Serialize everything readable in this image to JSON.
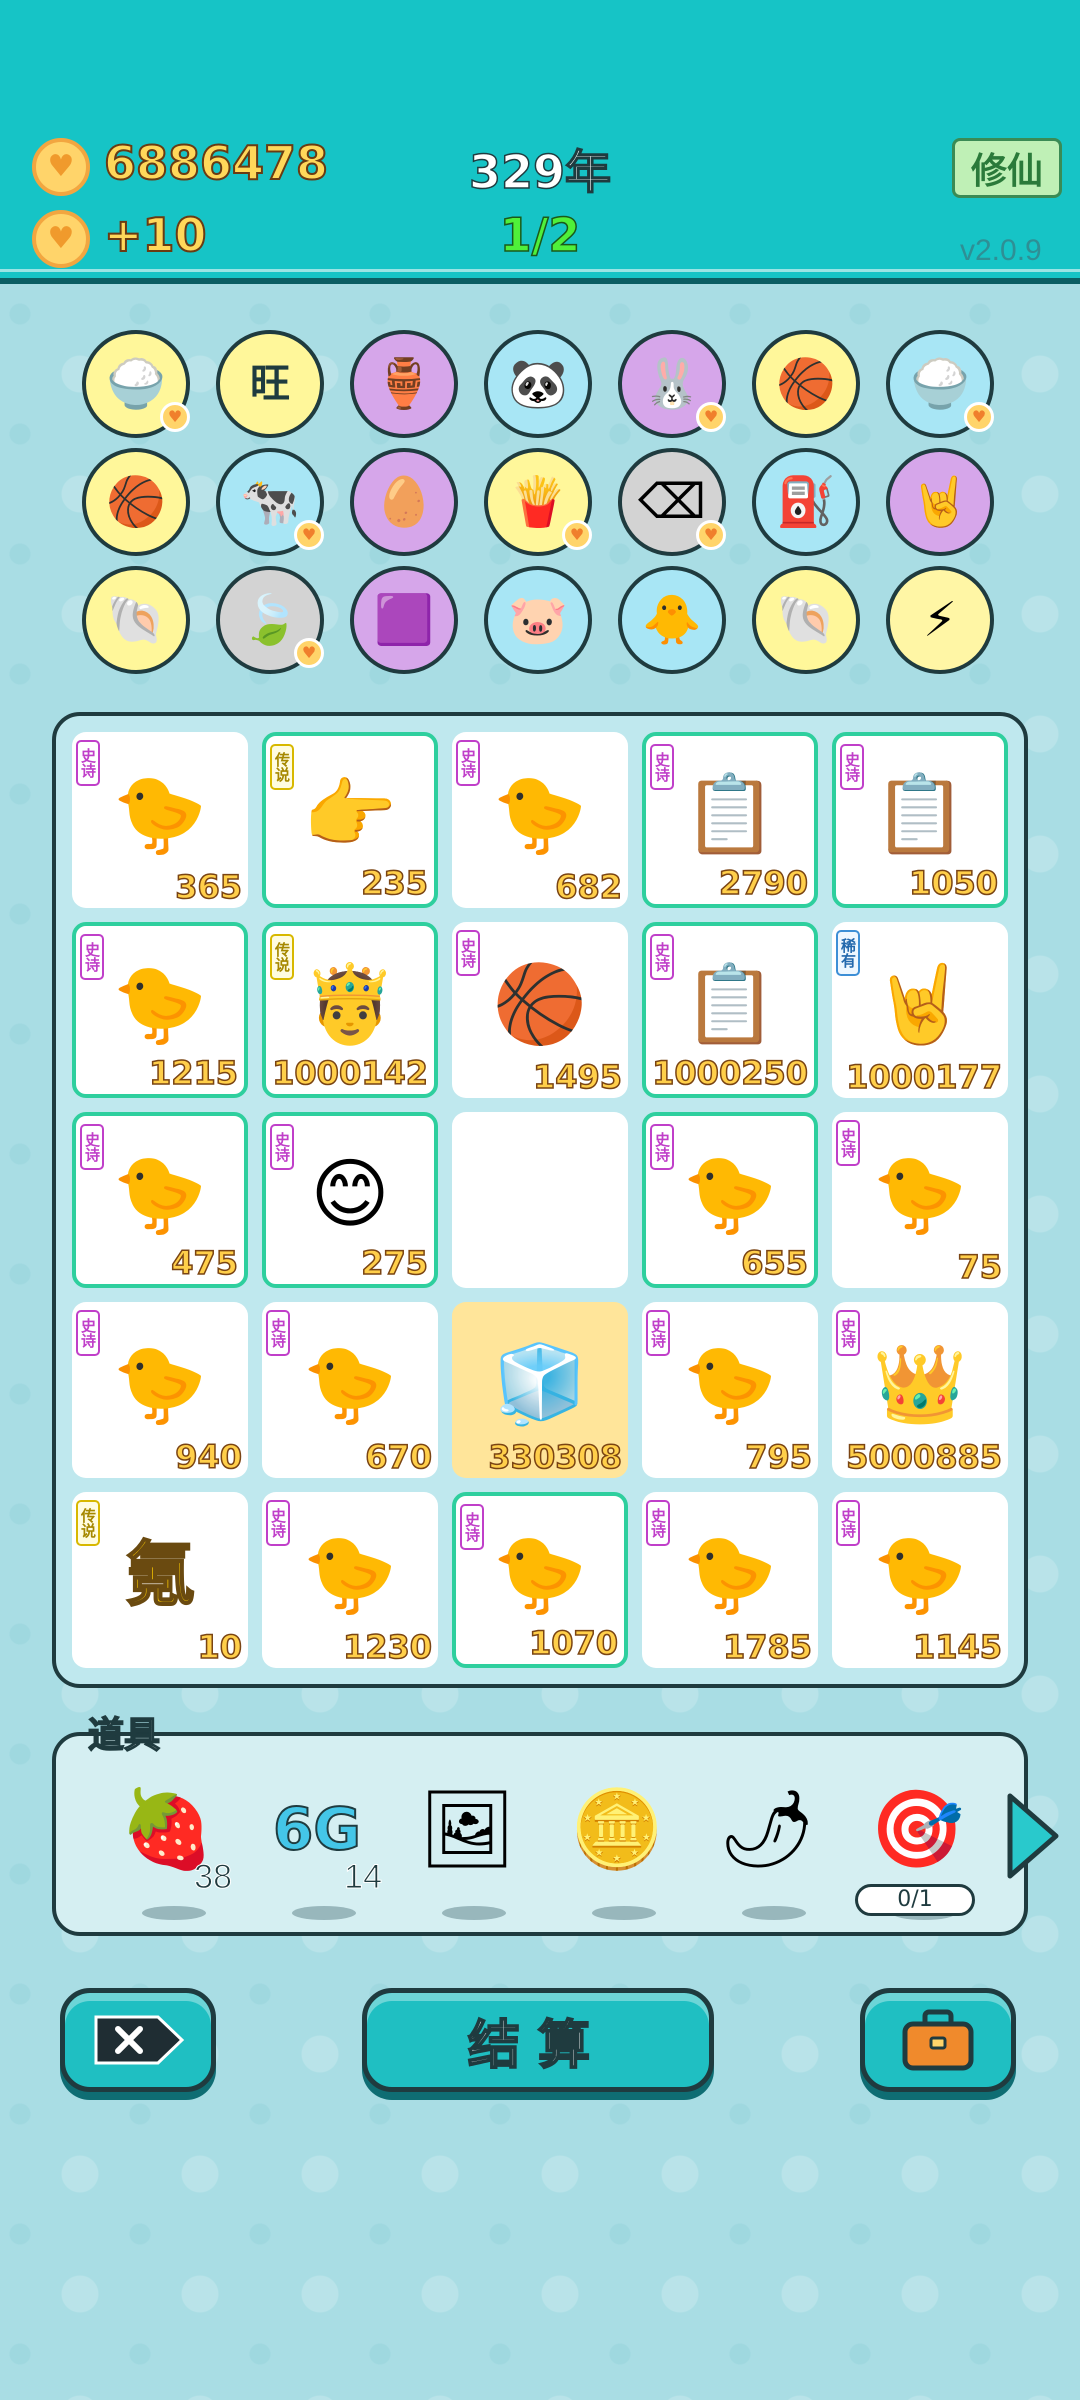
{
  "header": {
    "coins": "6886478",
    "coin_rate": "+10",
    "year": "329年",
    "progress": "1/2",
    "cultivate_button": "修仙",
    "version": "v2.0.9"
  },
  "icon_rows": [
    [
      {
        "icon": "🍚",
        "name": "rice-bowl-icon",
        "color": "yellow",
        "badge": true
      },
      {
        "icon": "旺",
        "name": "wang-character-icon",
        "color": "yellow",
        "badge": false
      },
      {
        "icon": "🏺",
        "name": "jar-icon",
        "color": "purple",
        "badge": false
      },
      {
        "icon": "🐼",
        "name": "panda-icon",
        "color": "blue",
        "badge": false
      },
      {
        "icon": "🐰",
        "name": "rabbit-icon",
        "color": "purple",
        "badge": true
      },
      {
        "icon": "🏀",
        "name": "basketball-icon",
        "color": "yellow",
        "badge": false
      },
      {
        "icon": "🍚",
        "name": "rice-bowl-icon",
        "color": "blue",
        "badge": true
      }
    ],
    [
      {
        "icon": "🏀",
        "name": "basketball-icon",
        "color": "yellow",
        "badge": false
      },
      {
        "icon": "🐄",
        "name": "cow-icon",
        "color": "blue",
        "badge": true
      },
      {
        "icon": "🥚",
        "name": "egg-icon",
        "color": "purple",
        "badge": false
      },
      {
        "icon": "🍟",
        "name": "fries-icon",
        "color": "yellow",
        "badge": true
      },
      {
        "icon": "⌫",
        "name": "delete-icon",
        "color": "gray",
        "badge": true
      },
      {
        "icon": "⛽",
        "name": "pump-icon",
        "color": "blue",
        "badge": false
      },
      {
        "icon": "🤘",
        "name": "rock-hand-icon",
        "color": "purple",
        "badge": false
      }
    ],
    [
      {
        "icon": "🐚",
        "name": "shell-icon",
        "color": "yellow",
        "badge": false
      },
      {
        "icon": "🍃",
        "name": "leaf-icon",
        "color": "gray",
        "badge": true
      },
      {
        "icon": "🟪",
        "name": "box-icon",
        "color": "purple",
        "badge": false
      },
      {
        "icon": "🐷",
        "name": "piggy-bank-icon",
        "color": "blue",
        "badge": false
      },
      {
        "icon": "🐥",
        "name": "chick-icon",
        "color": "blue",
        "badge": false
      },
      {
        "icon": "🐚",
        "name": "shell-icon",
        "color": "yellow",
        "badge": false
      },
      {
        "icon": "⚡",
        "name": "lightning-icon",
        "color": "lyellow",
        "badge": false
      }
    ]
  ],
  "board": {
    "rows": [
      [
        {
          "tag": "史诗",
          "tag_type": "epic",
          "icon": "🐤",
          "num": "365",
          "hl": false,
          "gold": false
        },
        {
          "tag": "传说",
          "tag_type": "legend",
          "icon": "👉",
          "num": "235",
          "hl": true,
          "gold": false
        },
        {
          "tag": "史诗",
          "tag_type": "epic",
          "icon": "🐤",
          "num": "682",
          "hl": false,
          "gold": false
        },
        {
          "tag": "史诗",
          "tag_type": "epic",
          "icon": "📋",
          "num": "2790",
          "hl": true,
          "gold": false
        },
        {
          "tag": "史诗",
          "tag_type": "epic",
          "icon": "📋",
          "num": "1050",
          "hl": true,
          "gold": false
        }
      ],
      [
        {
          "tag": "史诗",
          "tag_type": "epic",
          "icon": "🐤",
          "num": "1215",
          "hl": true,
          "gold": false
        },
        {
          "tag": "传说",
          "tag_type": "legend",
          "icon": "🤴",
          "num": "1000142",
          "hl": true,
          "gold": false
        },
        {
          "tag": "史诗",
          "tag_type": "epic",
          "icon": "🏀",
          "num": "1495",
          "hl": false,
          "gold": false
        },
        {
          "tag": "史诗",
          "tag_type": "epic",
          "icon": "📋",
          "num": "1000250",
          "hl": true,
          "gold": false
        },
        {
          "tag": "稀有",
          "tag_type": "rare",
          "icon": "🤘",
          "num": "1000177",
          "hl": false,
          "gold": false
        }
      ],
      [
        {
          "tag": "史诗",
          "tag_type": "epic",
          "icon": "🐤",
          "num": "475",
          "hl": true,
          "gold": false
        },
        {
          "tag": "史诗",
          "tag_type": "epic",
          "icon": "😊",
          "num": "275",
          "hl": true,
          "gold": false
        },
        {
          "tag": "",
          "tag_type": "none",
          "icon": "",
          "num": "",
          "hl": false,
          "gold": false
        },
        {
          "tag": "史诗",
          "tag_type": "epic",
          "icon": "🐤",
          "num": "655",
          "hl": true,
          "gold": false
        },
        {
          "tag": "史诗",
          "tag_type": "epic",
          "icon": "🐤",
          "num": "75",
          "hl": false,
          "gold": false
        }
      ],
      [
        {
          "tag": "史诗",
          "tag_type": "epic",
          "icon": "🐤",
          "num": "940",
          "hl": false,
          "gold": false
        },
        {
          "tag": "史诗",
          "tag_type": "epic",
          "icon": "🐤",
          "num": "670",
          "hl": false,
          "gold": false
        },
        {
          "tag": "",
          "tag_type": "none",
          "icon": "🧊",
          "num": "330308",
          "hl": false,
          "gold": true
        },
        {
          "tag": "史诗",
          "tag_type": "epic",
          "icon": "🐤",
          "num": "795",
          "hl": false,
          "gold": false
        },
        {
          "tag": "史诗",
          "tag_type": "epic",
          "icon": "👑",
          "num": "5000885",
          "hl": false,
          "gold": false
        }
      ],
      [
        {
          "tag": "传说",
          "tag_type": "legend",
          "icon": "氪",
          "num": "10",
          "hl": false,
          "gold": false
        },
        {
          "tag": "史诗",
          "tag_type": "epic",
          "icon": "🐤",
          "num": "1230",
          "hl": false,
          "gold": false
        },
        {
          "tag": "史诗",
          "tag_type": "epic",
          "icon": "🐤",
          "num": "1070",
          "hl": true,
          "gold": false
        },
        {
          "tag": "史诗",
          "tag_type": "epic",
          "icon": "🐤",
          "num": "1785",
          "hl": false,
          "gold": false
        },
        {
          "tag": "史诗",
          "tag_type": "epic",
          "icon": "🐤",
          "num": "1145",
          "hl": false,
          "gold": false
        }
      ]
    ]
  },
  "items": {
    "label": "道具",
    "list": [
      {
        "icon": "🍓",
        "name": "strawberry-icon",
        "count": "38"
      },
      {
        "icon": "6G",
        "name": "6g-icon",
        "count": "14"
      },
      {
        "icon": "🖼",
        "name": "frame-icon",
        "count": ""
      },
      {
        "icon": "🪙",
        "name": "coin-icon",
        "count": ""
      },
      {
        "icon": "🌶",
        "name": "chili-icon",
        "count": ""
      },
      {
        "icon": "🎯",
        "name": "target-icon",
        "count": ""
      }
    ],
    "ratio": "0/1"
  },
  "buttons": {
    "settle_label": "结算"
  },
  "colors": {
    "header_bg": "#16c4c6",
    "page_bg": "#a9dde4",
    "number_yellow": "#ffcf4a",
    "highlight": "#2ecf9e"
  }
}
